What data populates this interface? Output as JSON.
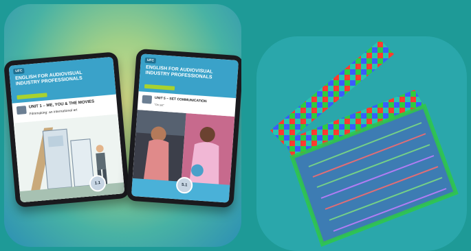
{
  "tablet_left": {
    "brand": "UFC",
    "title": "English for Audiovisual Industry Professionals",
    "unit_heading": "UNIT 1 – ME, YOU & THE MOVIES",
    "unit_sub": "Filmmaking: an international art",
    "badge": "1.1"
  },
  "tablet_right": {
    "brand": "UFC",
    "title": "English for Audiovisual Industry Professionals",
    "unit_heading": "UNIT 5 – SET COMMUNICATION",
    "unit_sub": "\"On set\"",
    "badge": "5.1"
  },
  "icons": {
    "clapperboard": "clapperboard-icon"
  },
  "colors": {
    "page_bg": "#1e9a97",
    "right_tile_bg": "#2aa7ab",
    "header_blue": "#3aa2c9",
    "accent_green": "#a8d22e"
  }
}
